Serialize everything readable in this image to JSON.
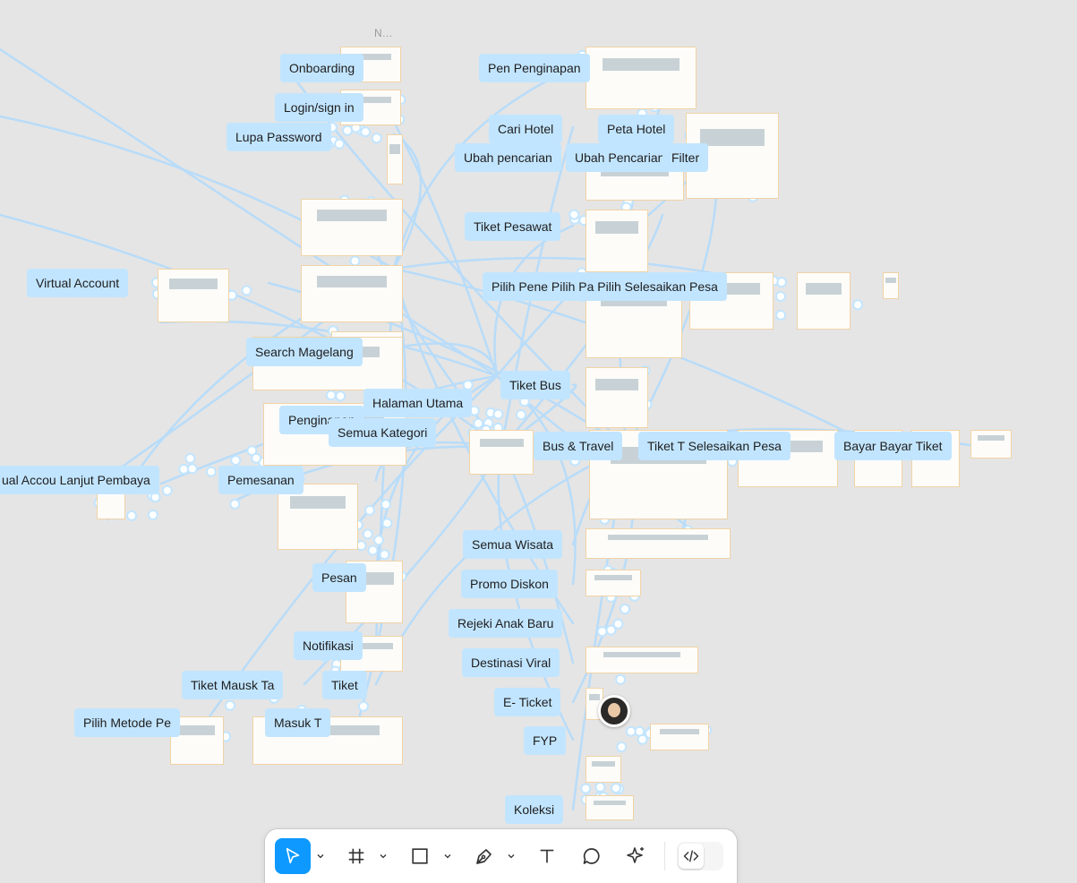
{
  "canvas": {
    "background": "#e5e5e5",
    "accent": "#c2e5ff",
    "connector_color": "#b8dcf9",
    "frame_title_fragment": "N…",
    "flow_labels": [
      "Onboarding",
      "Login/sign in",
      "Lupa Password",
      "Pen  Penginapan",
      "Cari Hotel",
      "Peta Hotel",
      "Ubah pencarian",
      "Ubah Pencarian",
      "Filter",
      "Tiket Pesawat",
      "Pilih Pene  Pilih Pa  Pilih  Selesaikan Pesa",
      "Virtual Account",
      "Search Magelang",
      "Tiket Bus",
      "Halaman Utama",
      "Penginapan",
      "Semua Kategori",
      "Bus & Travel",
      "Tiket T  Selesaikan Pesa",
      "Bayar  Bayar Tiket",
      "ual Accou  Lanjut Pembaya",
      "Pemesanan",
      "Semua Wisata",
      "Promo Diskon",
      "Rejeki Anak Baru",
      "Destinasi Viral",
      "Pesan",
      "Notifikasi",
      "Tiket Mausk Ta",
      "Tiket",
      "Pilih Metode Pe",
      "Masuk T",
      "E- Ticket",
      "FYP",
      "Koleksi"
    ]
  },
  "collaborator": {
    "avatar": "user-avatar"
  },
  "toolbar": {
    "tools": [
      {
        "name": "move-tool",
        "icon": "cursor-icon",
        "active": true
      },
      {
        "name": "frame-tool",
        "icon": "frame-hash-icon",
        "active": false
      },
      {
        "name": "shape-tool",
        "icon": "rectangle-icon",
        "active": false
      },
      {
        "name": "pen-tool",
        "icon": "pen-icon",
        "active": false
      },
      {
        "name": "text-tool",
        "icon": "text-icon",
        "active": false
      },
      {
        "name": "comment-tool",
        "icon": "comment-icon",
        "active": false
      },
      {
        "name": "actions-tool",
        "icon": "sparkle-icon",
        "active": false
      }
    ],
    "dev_mode": {
      "icon": "code-icon",
      "enabled": false
    },
    "active_color": "#0d99ff"
  }
}
